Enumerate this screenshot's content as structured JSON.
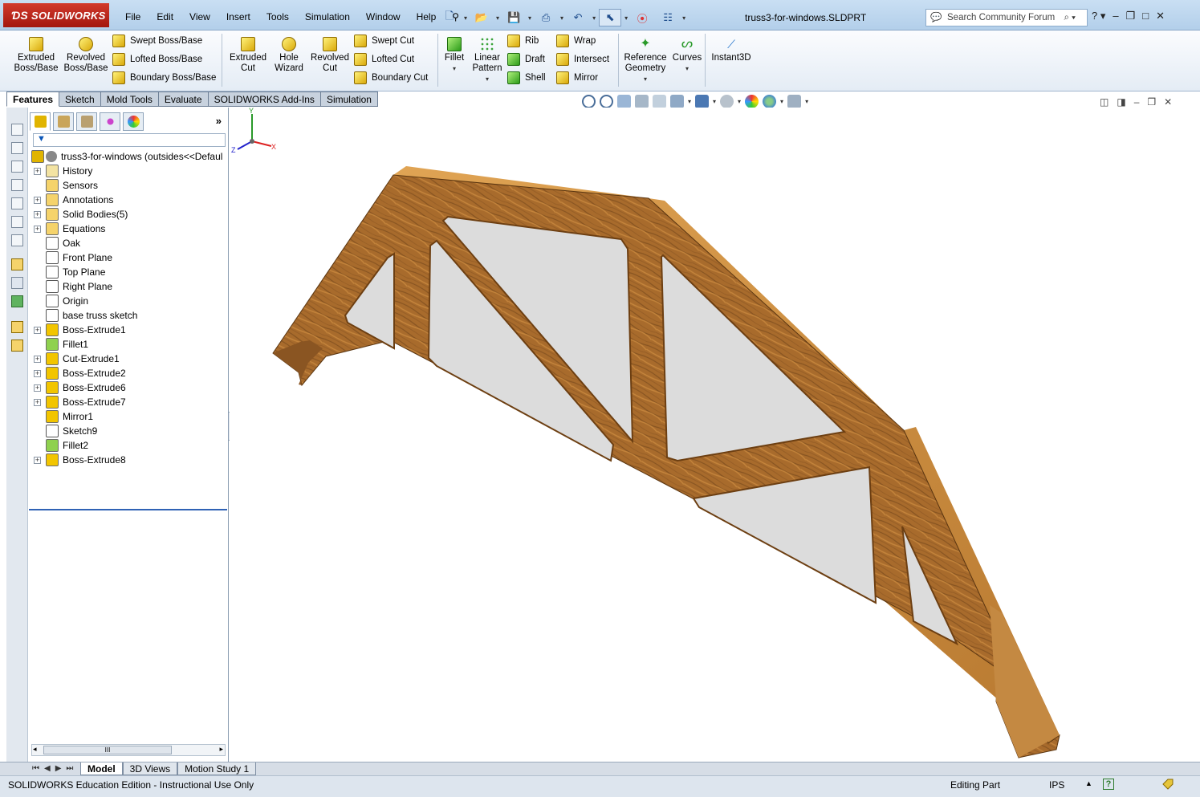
{
  "app": {
    "brand": "SOLIDWORKS",
    "document_title": "truss3-for-windows.SLDPRT"
  },
  "menu": [
    "File",
    "Edit",
    "View",
    "Insert",
    "Tools",
    "Simulation",
    "Window",
    "Help"
  ],
  "search": {
    "placeholder": "Search Community Forum"
  },
  "ribbon": {
    "extruded_boss": "Extruded Boss/Base",
    "revolved_boss": "Revolved Boss/Base",
    "swept_boss": "Swept Boss/Base",
    "lofted_boss": "Lofted Boss/Base",
    "boundary_boss": "Boundary Boss/Base",
    "extruded_cut": "Extruded Cut",
    "hole_wizard": "Hole Wizard",
    "revolved_cut": "Revolved Cut",
    "swept_cut": "Swept Cut",
    "lofted_cut": "Lofted Cut",
    "boundary_cut": "Boundary Cut",
    "fillet": "Fillet",
    "linear_pattern": "Linear Pattern",
    "rib": "Rib",
    "draft": "Draft",
    "shell": "Shell",
    "wrap": "Wrap",
    "intersect": "Intersect",
    "mirror": "Mirror",
    "reference_geometry": "Reference Geometry",
    "curves": "Curves",
    "instant3d": "Instant3D"
  },
  "tabs": [
    "Features",
    "Sketch",
    "Mold Tools",
    "Evaluate",
    "SOLIDWORKS Add-Ins",
    "Simulation"
  ],
  "feature_tree": {
    "root": "truss3-for-windows  (outsides<<Defaul",
    "nodes": [
      {
        "label": "History",
        "expandable": true,
        "icon": "history-icon"
      },
      {
        "label": "Sensors",
        "expandable": false,
        "icon": "sensors-icon"
      },
      {
        "label": "Annotations",
        "expandable": true,
        "icon": "annotations-icon"
      },
      {
        "label": "Solid Bodies(5)",
        "expandable": true,
        "icon": "solid-bodies-icon"
      },
      {
        "label": "Equations",
        "expandable": true,
        "icon": "equations-icon"
      },
      {
        "label": "Oak",
        "expandable": false,
        "icon": "material-icon"
      },
      {
        "label": "Front Plane",
        "expandable": false,
        "icon": "plane-icon"
      },
      {
        "label": "Top Plane",
        "expandable": false,
        "icon": "plane-icon"
      },
      {
        "label": "Right Plane",
        "expandable": false,
        "icon": "plane-icon"
      },
      {
        "label": "Origin",
        "expandable": false,
        "icon": "origin-icon"
      },
      {
        "label": "base truss sketch",
        "expandable": false,
        "icon": "sketch-icon"
      },
      {
        "label": "Boss-Extrude1",
        "expandable": true,
        "icon": "boss-extrude-icon"
      },
      {
        "label": "Fillet1",
        "expandable": false,
        "icon": "fillet-icon"
      },
      {
        "label": "Cut-Extrude1",
        "expandable": true,
        "icon": "cut-extrude-icon"
      },
      {
        "label": "Boss-Extrude2",
        "expandable": true,
        "icon": "boss-extrude-icon"
      },
      {
        "label": "Boss-Extrude6",
        "expandable": true,
        "icon": "boss-extrude-icon"
      },
      {
        "label": "Boss-Extrude7",
        "expandable": true,
        "icon": "boss-extrude-icon"
      },
      {
        "label": "Mirror1",
        "expandable": false,
        "icon": "mirror-feature-icon"
      },
      {
        "label": "Sketch9",
        "expandable": false,
        "icon": "sketch-icon"
      },
      {
        "label": "Fillet2",
        "expandable": false,
        "icon": "fillet-icon"
      },
      {
        "label": "Boss-Extrude8",
        "expandable": true,
        "icon": "boss-extrude-icon"
      }
    ]
  },
  "scrollbar_grip": "III",
  "bottom_tabs": [
    "Model",
    "3D Views",
    "Motion Study 1"
  ],
  "triad": {
    "x": "X",
    "y": "Y",
    "z": "Z"
  },
  "status": {
    "edition": "SOLIDWORKS Education Edition - Instructional Use Only",
    "mode": "Editing Part",
    "units": "IPS"
  },
  "colors": {
    "wood_light": "#c98a3e",
    "wood_dark": "#7a4a1c",
    "cutout_fill": "#dcdcdc",
    "title_bar": "#c9dff3"
  }
}
